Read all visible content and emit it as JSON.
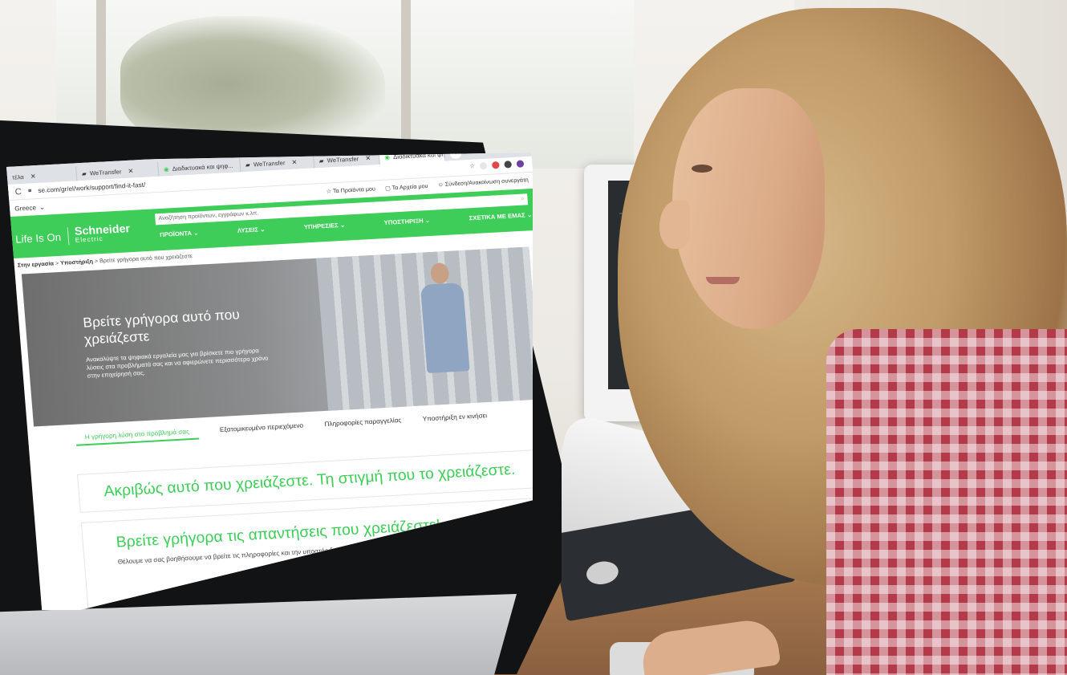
{
  "browser": {
    "tabs": [
      {
        "label": "τέλα",
        "active": false
      },
      {
        "label": "WeTransfer",
        "active": false
      },
      {
        "label": "Διαδικτυακά και ψηφ...",
        "active": false
      },
      {
        "label": "WeTransfer",
        "active": false
      },
      {
        "label": "WeTransfer",
        "active": false
      },
      {
        "label": "Διαδικτυακά και ψηφ...",
        "active": true
      }
    ],
    "url": "se.com/gr/el/work/support/find-it-fast/"
  },
  "site": {
    "country": "Greece",
    "top_links": [
      "Τα Προϊόντα μου",
      "Τα Αρχεία μου",
      "Σύνδεση/Ανακοίνωση συνεργάτη"
    ],
    "brand_tagline": "Life Is On",
    "brand_name": "Schneider",
    "brand_sub": "Electric",
    "search_placeholder": "Αναζήτηση προϊόντων, εγγράφων κ.λπ.",
    "nav": [
      "ΠΡΟΪΟΝΤΑ",
      "ΛΥΣΕΙΣ",
      "ΥΠΗΡΕΣΙΕΣ",
      "ΥΠΟΣΤΗΡΙΞΗ",
      "ΣΧΕΤΙΚΑ ΜΕ ΕΜΑΣ"
    ],
    "breadcrumb": [
      "Στην εργασία",
      "Υποστήριξη",
      "Βρείτε γρήγορα αυτό που χρειάζεστε"
    ]
  },
  "hero": {
    "title": "Βρείτε γρήγορα αυτό που χρειάζεστε",
    "subtitle": "Ανακαλύψτε τα ψηφιακά εργαλεία μας για βρίσκετε πιο γρήγορα λύσεις στα προβλήματά σας και να αφιερώνετε περισσότερο χρόνο στην επιχείρησή σας."
  },
  "content_tabs": [
    {
      "label": "Η γρήγορη λύση στο πρόβλημά σας",
      "active": true
    },
    {
      "label": "Εξατομικευμένο περιεχόμενο",
      "active": false
    },
    {
      "label": "Πληροφορίες παραγγελίας",
      "active": false
    },
    {
      "label": "Υποστήριξη εν κινήσει",
      "active": false
    }
  ],
  "sections": {
    "heading1": "Ακριβώς αυτό που χρειάζεστε. Τη στιγμή που το χρειάζεστε.",
    "heading2": "Βρείτε γρήγορα τις απαντήσεις που χρειάζεστε!",
    "body": "Θέλουμε να σας βοηθήσουμε να βρείτε τις πληροφορίες και την υποστήριξη που χρειάζεστε γρήγορα και απλά, ώστε να μπορείτε να συνεχίσετε τις"
  },
  "colors": {
    "brand_green": "#3dcd58",
    "tab_bar": "#dee1e6"
  }
}
